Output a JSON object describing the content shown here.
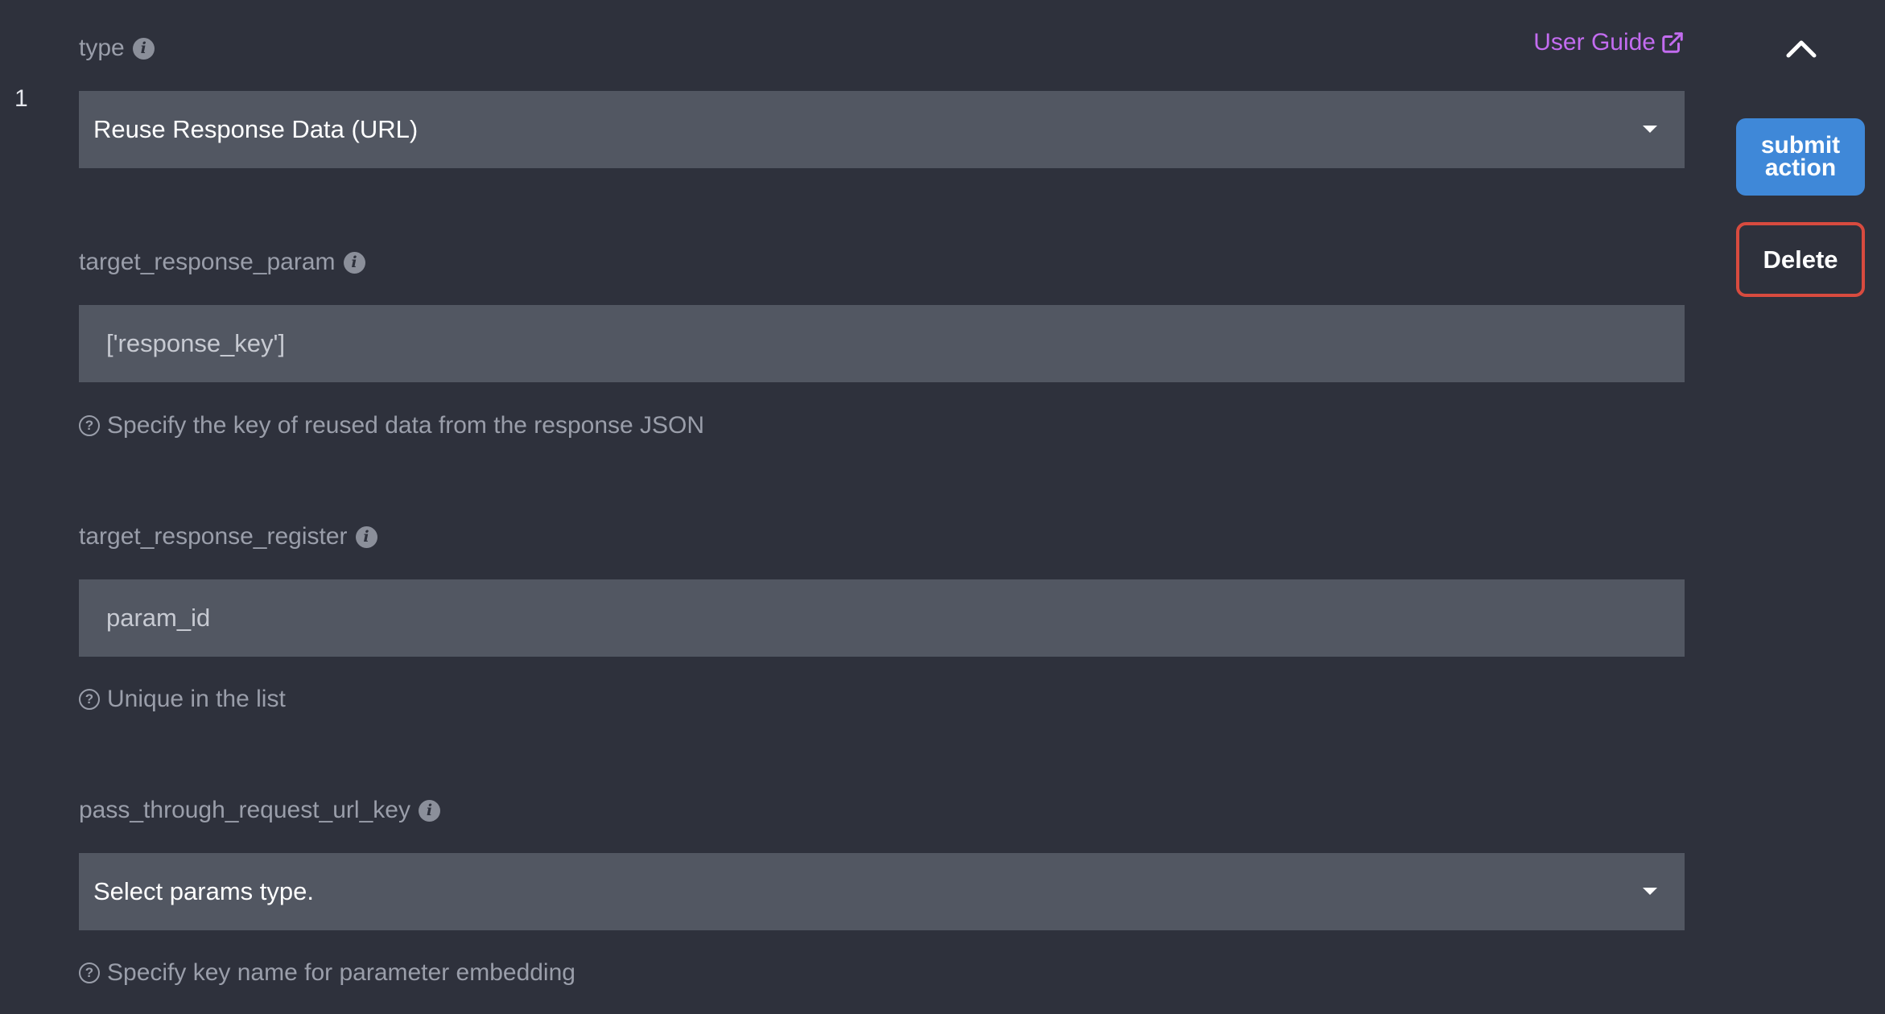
{
  "row": {
    "index": "1"
  },
  "header": {
    "type_label": "type",
    "user_guide": "User Guide"
  },
  "fields": {
    "type": {
      "value": "Reuse Response Data (URL)"
    },
    "target_response_param": {
      "label": "target_response_param",
      "placeholder": "['response_key']",
      "help": "Specify the key of reused data from the response JSON"
    },
    "target_response_register": {
      "label": "target_response_register",
      "placeholder": "param_id",
      "help": "Unique in the list"
    },
    "pass_through_request_url_key": {
      "label": "pass_through_request_url_key",
      "value": "Select params type.",
      "help": "Specify key name for parameter embedding"
    }
  },
  "actions": {
    "submit_label": "submit action",
    "delete_label": "Delete"
  },
  "icons": {
    "info": "info-icon",
    "help": "question-circle-icon",
    "external": "external-link-icon",
    "collapse": "chevron-up-icon",
    "dropdown": "caret-down-icon"
  },
  "colors": {
    "background": "#2e313c",
    "field": "#525762",
    "link": "#c36cf0",
    "primary": "#3f88d8",
    "danger": "#d84b3f"
  }
}
